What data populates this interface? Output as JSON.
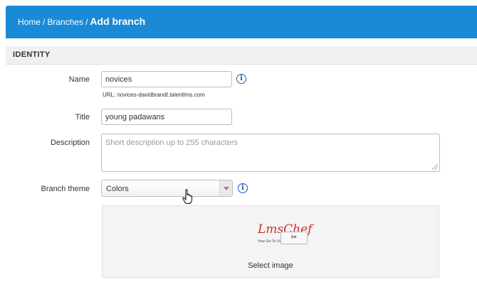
{
  "breadcrumb": {
    "home": "Home",
    "branches": "Branches",
    "separator": "/",
    "current": "Add branch"
  },
  "section": {
    "title": "IDENTITY"
  },
  "form": {
    "name": {
      "label": "Name",
      "value": "novices",
      "url_hint": "URL: novices-davidbrandt.talentlms.com"
    },
    "title": {
      "label": "Title",
      "value": "young padawans"
    },
    "description": {
      "label": "Description",
      "placeholder": "Short description up to 255 characters",
      "value": ""
    },
    "branch_theme": {
      "label": "Branch theme",
      "selected": "Colors"
    },
    "image": {
      "logo_text": "LmsChef",
      "logo_tagline": "Your Go-To LMS Companion",
      "crop_glyph": "✂",
      "select_label": "Select image"
    }
  },
  "icons": {
    "info": "info-icon",
    "cursor": "hand-pointer-icon",
    "crop": "scissors-icon"
  },
  "colors": {
    "header_bg": "#1a8ad6",
    "info_icon": "#1a5fb4",
    "logo": "#c4302b"
  }
}
